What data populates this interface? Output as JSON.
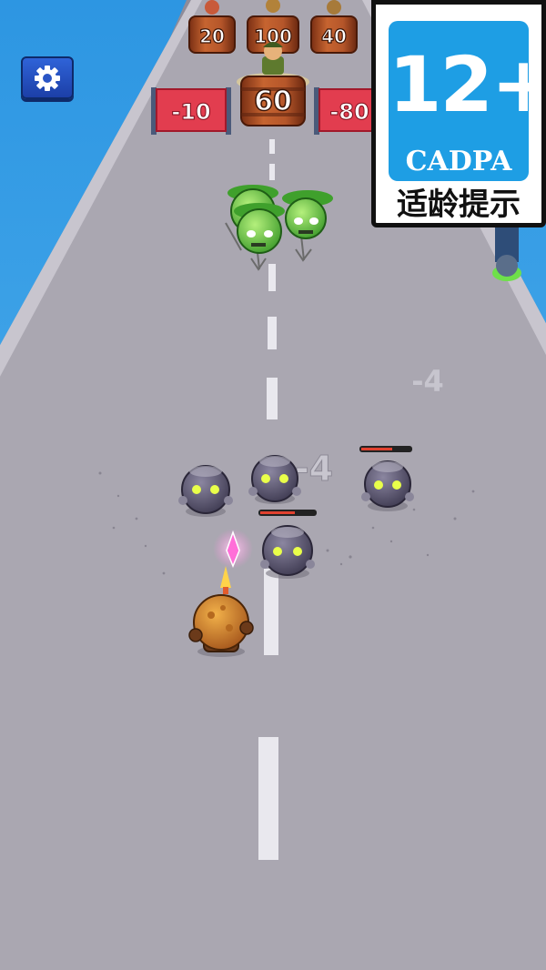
{
  "scene": {
    "barrels_top": [
      "20",
      "100",
      "40"
    ],
    "barrel_main": "60",
    "gate_left": "-10",
    "gate_right": "-80",
    "damage_popups": [
      "-4",
      "-4"
    ]
  },
  "hud": {
    "settings_icon": "gear-icon"
  },
  "age_rating": {
    "number": "12+",
    "org": "CADPA",
    "caption": "适龄提示"
  },
  "colors": {
    "sky": "#2f9be6",
    "road": "#a9a6b0",
    "gate": "#e23d4f",
    "barrel": "#b5562a",
    "zombie_green": "#6fd34a",
    "zombie_gray": "#5d5870",
    "badge_blue": "#1e9ee4"
  }
}
